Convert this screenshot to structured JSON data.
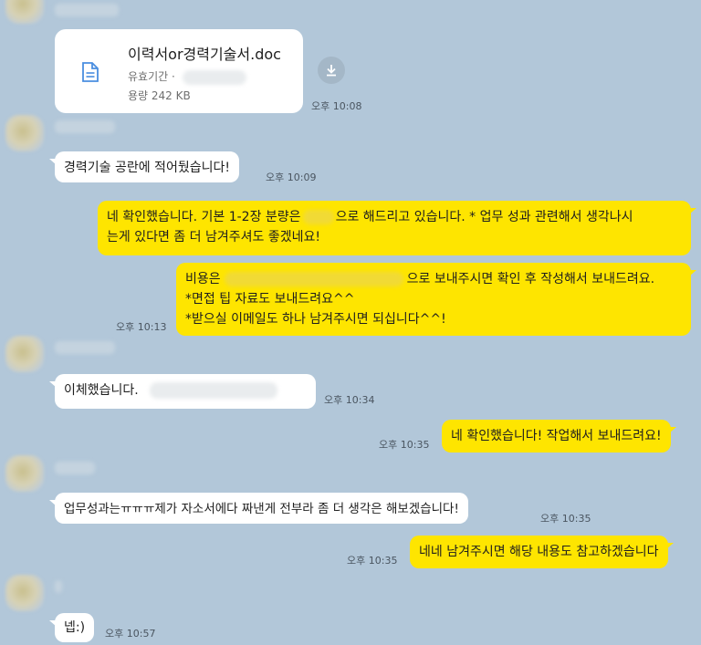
{
  "messages": {
    "file": {
      "name": "이력서or경력기술서.doc",
      "expiry_label": "유효기간 ·",
      "size": "용량 242 KB",
      "time": "오후 10:08"
    },
    "m1": {
      "text": "경력기술 공란에 적어뒀습니다!",
      "time": "오후 10:09"
    },
    "m2": {
      "line1_pre": "네 확인했습니다. 기본 1-2장 분량은",
      "line1_post": "으로 해드리고 있습니다. * 업무 성과 관련해서 생각나시",
      "line2": "는게 있다면 좀 더 남겨주셔도 좋겠네요!"
    },
    "m3": {
      "line1_pre": "비용은",
      "line1_post": "으로 보내주시면 확인 후 작성해서 보내드려요.",
      "line2": "*면접 팁 자료도 보내드려요^^",
      "line3": "*받으실 이메일도 하나 남겨주시면 되십니다^^!",
      "time": "오후 10:13"
    },
    "m4": {
      "text": "이체했습니다.",
      "time": "오후 10:34"
    },
    "m5": {
      "text": "네 확인했습니다! 작업해서 보내드려요!",
      "time": "오후 10:35"
    },
    "m6": {
      "text": "업무성과는ㅠㅠㅠ제가 자소서에다 짜낸게 전부라 좀 더 생각은 해보겠습니다!",
      "time": "오후 10:35"
    },
    "m7": {
      "text": "네네 남겨주시면 해당 내용도 참고하겠습니다",
      "time": "오후 10:35"
    },
    "m8": {
      "text": "넵:)",
      "time": "오후 10:57"
    }
  },
  "colors": {
    "background": "#b2c7d9",
    "my_bubble": "#fee500",
    "their_bubble": "#ffffff"
  },
  "icons": {
    "file": "document-icon",
    "download": "download-icon"
  }
}
